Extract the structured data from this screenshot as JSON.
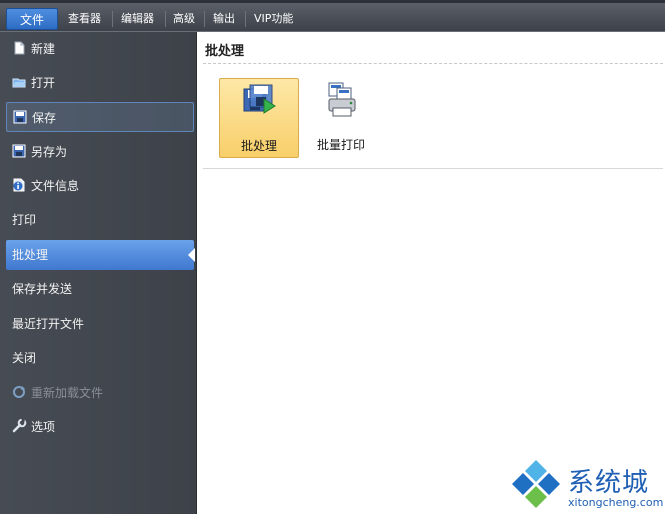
{
  "menubar": {
    "tabs": [
      "文件",
      "查看器",
      "编辑器",
      "高级",
      "输出",
      "VIP功能"
    ]
  },
  "sidebar": {
    "items": [
      {
        "label": "新建",
        "icon": "new-document-icon"
      },
      {
        "label": "打开",
        "icon": "open-folder-icon"
      },
      {
        "label": "保存",
        "icon": "save-disk-icon"
      },
      {
        "label": "另存为",
        "icon": "save-as-icon"
      },
      {
        "label": "文件信息",
        "icon": "info-icon"
      },
      {
        "label": "打印",
        "icon": ""
      },
      {
        "label": "批处理",
        "icon": ""
      },
      {
        "label": "保存并发送",
        "icon": ""
      },
      {
        "label": "最近打开文件",
        "icon": ""
      },
      {
        "label": "关闭",
        "icon": ""
      },
      {
        "label": "重新加载文件",
        "icon": "reload-icon"
      },
      {
        "label": "选项",
        "icon": "wrench-icon"
      }
    ],
    "active": "批处理",
    "disabled": "重新加载文件"
  },
  "content": {
    "title": "批处理",
    "buttons": [
      {
        "label": "批处理",
        "icon": "batch-save-icon",
        "selected": true
      },
      {
        "label": "批量打印",
        "icon": "batch-print-icon",
        "selected": false
      }
    ]
  },
  "watermark": {
    "name": "系统城",
    "url": "xitongcheng.com"
  },
  "colors": {
    "active_item": "#4f88db",
    "selected_button": "#f9d97f",
    "watermark": "#1f5fb4"
  }
}
